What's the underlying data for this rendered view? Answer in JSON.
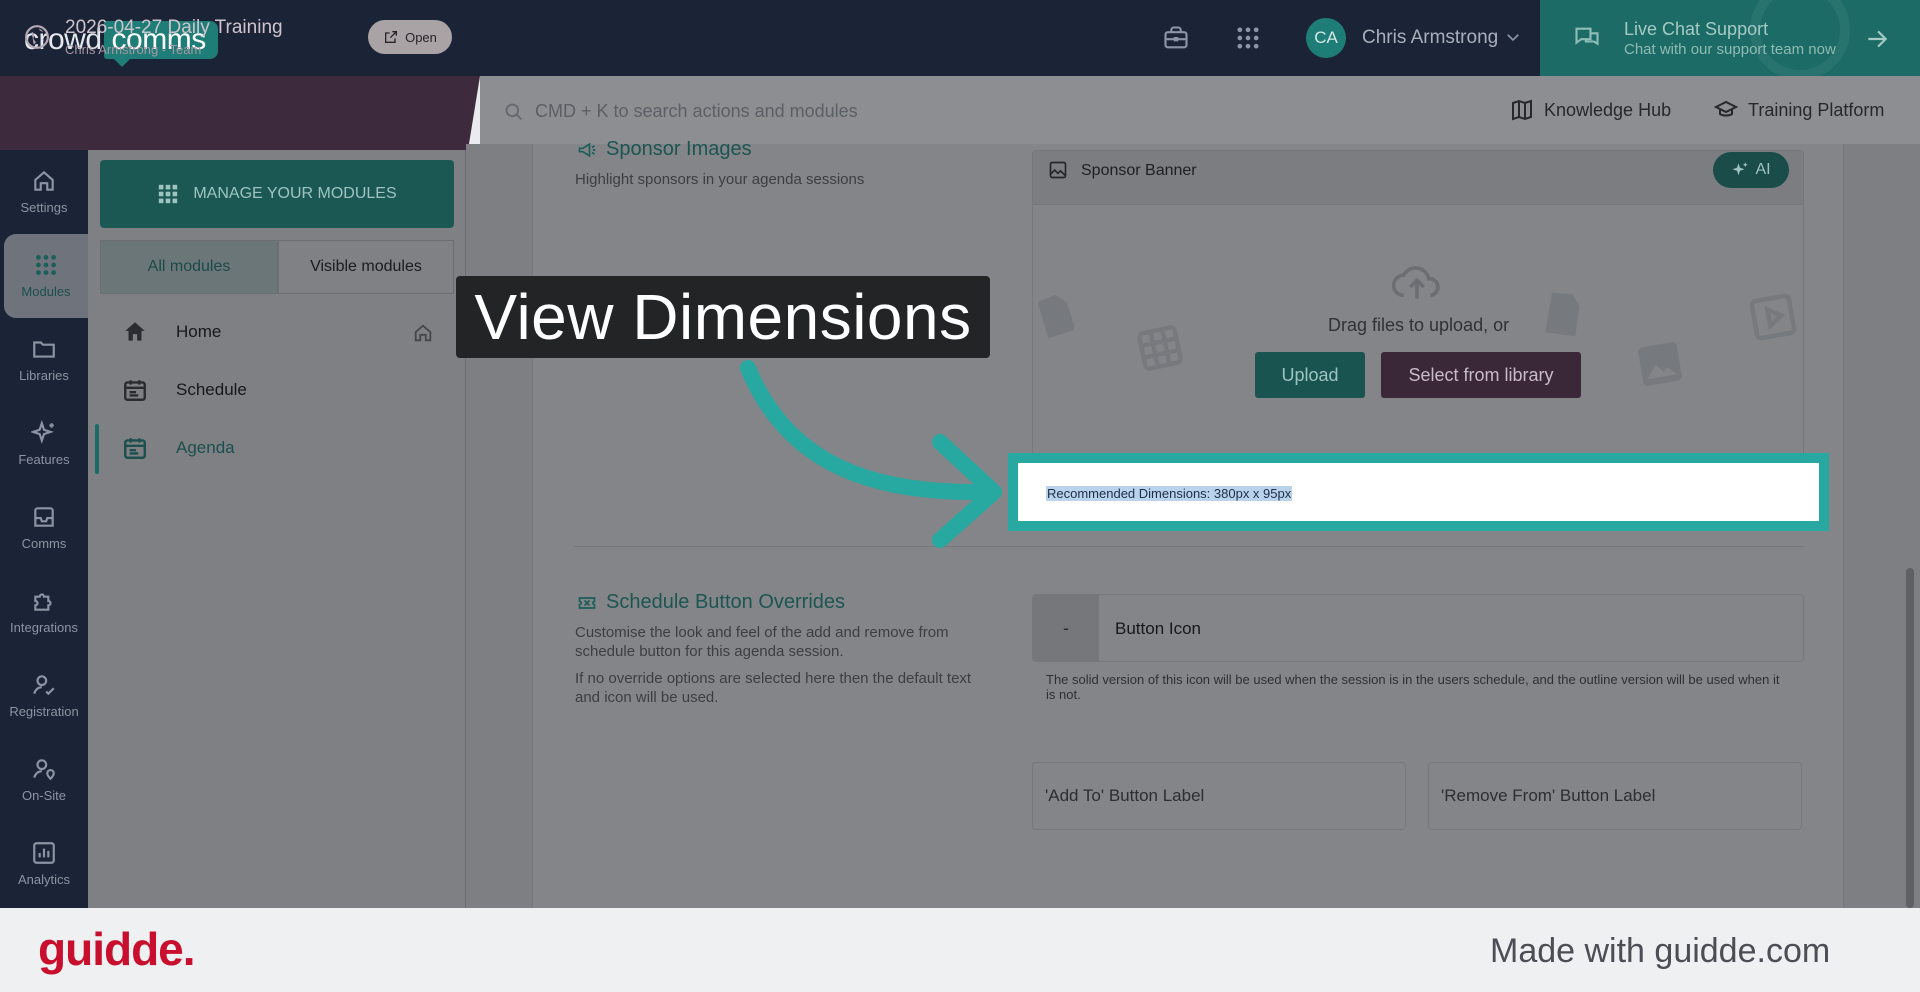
{
  "app": {
    "logo_part1": "crowd",
    "logo_part2": "comms",
    "user_initials": "CA",
    "user_name": "Chris Armstrong"
  },
  "chat_support": {
    "title": "Live Chat Support",
    "subtitle": "Chat with our support team now"
  },
  "event": {
    "title": "2026-04-27 Daily Training",
    "subtitle": "Chris Armstrong - Team",
    "open_label": "Open"
  },
  "search": {
    "placeholder": "CMD + K to search actions and modules"
  },
  "header_links": {
    "knowledge_hub": "Knowledge Hub",
    "training_platform": "Training Platform"
  },
  "left_nav": {
    "items": [
      {
        "label": "Settings",
        "icon": "home-icon"
      },
      {
        "label": "Modules",
        "icon": "grid-icon"
      },
      {
        "label": "Libraries",
        "icon": "folder-icon"
      },
      {
        "label": "Features",
        "icon": "sparkle-icon"
      },
      {
        "label": "Comms",
        "icon": "inbox-icon"
      },
      {
        "label": "Integrations",
        "icon": "puzzle-icon"
      },
      {
        "label": "Registration",
        "icon": "user-check-icon"
      },
      {
        "label": "On-Site",
        "icon": "user-pin-icon"
      },
      {
        "label": "Analytics",
        "icon": "chart-icon"
      }
    ],
    "active": "Modules"
  },
  "module_panel": {
    "manage_label": "MANAGE YOUR MODULES",
    "tabs": [
      "All modules",
      "Visible modules"
    ],
    "active_tab": "All modules",
    "items": [
      {
        "label": "Home",
        "icon": "house-icon"
      },
      {
        "label": "Schedule",
        "icon": "calendar-icon"
      },
      {
        "label": "Agenda",
        "icon": "calendar-icon"
      }
    ],
    "active_item": "Agenda"
  },
  "sponsor_images": {
    "title": "Sponsor Images",
    "description": "Highlight sponsors in your agenda sessions",
    "banner_label": "Sponsor Banner",
    "ai_label": "AI",
    "drag_text": "Drag files to upload, or",
    "upload_label": "Upload",
    "library_label": "Select from library",
    "dimensions_text": "Recommended Dimensions: 380px x 95px"
  },
  "schedule_overrides": {
    "title": "Schedule Button Overrides",
    "description_1": "Customise the look and feel of the add and remove from schedule button for this agenda session.",
    "description_2": "If no override options are selected here then the default text and icon will be used.",
    "icon_placeholder": "-",
    "button_icon_label": "Button Icon",
    "help_text": "The solid version of this icon will be used when the session is in the users schedule, and the outline version will be used when it is not.",
    "add_label": "'Add To' Button Label",
    "remove_label": "'Remove From' Button Label"
  },
  "annotation": {
    "callout_text": "View Dimensions"
  },
  "footer": {
    "brand": "guidde.",
    "made_with": "Made with guidde.com"
  },
  "colors": {
    "topbar": "#1b2436",
    "teal_accent": "#27a9a2",
    "brand_red": "#c8102e"
  }
}
